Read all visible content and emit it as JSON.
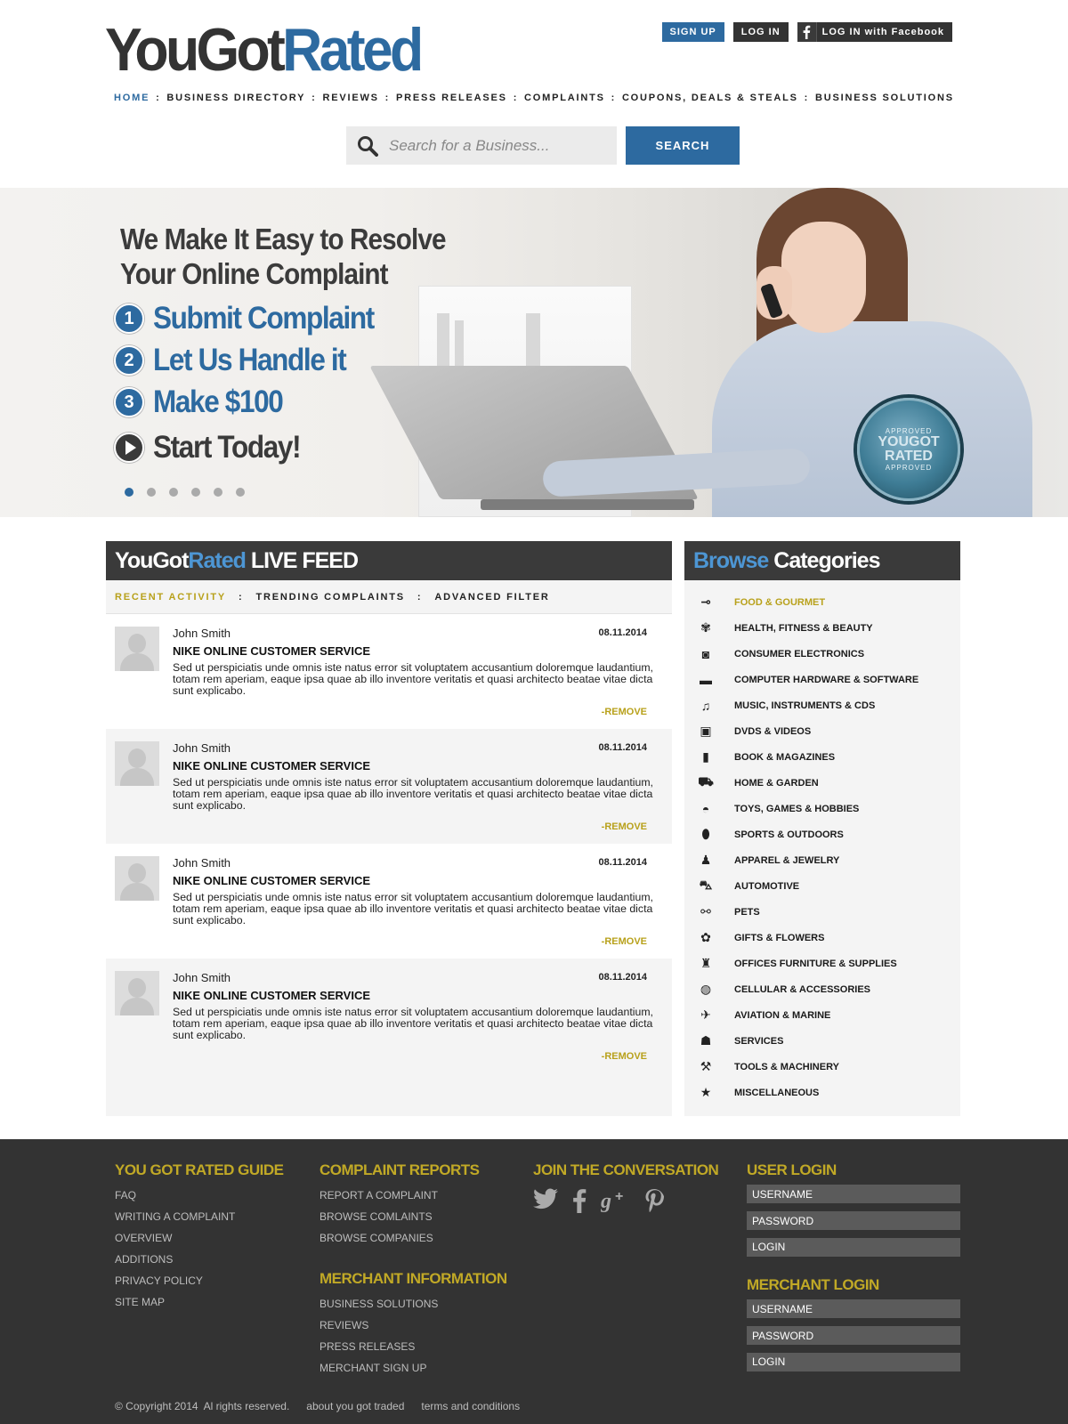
{
  "brand": {
    "part1": "YouGot",
    "part2": "Rated"
  },
  "auth": {
    "signup": "SIGN UP",
    "login": "LOG IN",
    "facebook": "LOG IN with Facebook"
  },
  "nav": {
    "items": [
      "HOME",
      "BUSINESS DIRECTORY",
      "REVIEWS",
      "PRESS RELEASES",
      "COMPLAINTS",
      "COUPONS, DEALS & STEALS",
      "BUSINESS SOLUTIONS"
    ],
    "separator": ":"
  },
  "search": {
    "placeholder": "Search for a Business...",
    "button": "SEARCH"
  },
  "hero": {
    "title_line1": "We Make It Easy to Resolve",
    "title_line2": "Your Online Complaint",
    "steps": [
      {
        "num": "1",
        "label": "Submit Complaint"
      },
      {
        "num": "2",
        "label": "Let Us Handle it"
      },
      {
        "num": "3",
        "label": "Make $100"
      }
    ],
    "cta": "Start Today!",
    "badge": {
      "top": "APPROVED",
      "line1": "YOUGOT",
      "line2": "RATED",
      "bottom": "APPROVED"
    }
  },
  "feed": {
    "head_part1": "YouGot",
    "head_part2": "Rated",
    "head_part3": " LIVE FEED",
    "tabs": [
      "RECENT ACTIVITY",
      "TRENDING COMPLAINTS",
      "ADVANCED FILTER"
    ],
    "items": [
      {
        "name": "John Smith",
        "date": "08.11.2014",
        "title": "NIKE ONLINE CUSTOMER SERVICE",
        "text": "Sed ut perspiciatis unde omnis iste natus error sit voluptatem accusantium doloremque laudantium, totam rem aperiam, eaque ipsa quae ab illo inventore veritatis et quasi architecto beatae vitae dicta sunt explicabo.",
        "remove": "-REMOVE"
      },
      {
        "name": "John Smith",
        "date": "08.11.2014",
        "title": "NIKE ONLINE CUSTOMER SERVICE",
        "text": "Sed ut perspiciatis unde omnis iste natus error sit voluptatem accusantium doloremque laudantium, totam rem aperiam, eaque ipsa quae ab illo inventore veritatis et quasi architecto beatae vitae dicta sunt explicabo.",
        "remove": "-REMOVE"
      },
      {
        "name": "John Smith",
        "date": "08.11.2014",
        "title": "NIKE ONLINE CUSTOMER SERVICE",
        "text": "Sed ut perspiciatis unde omnis iste natus error sit voluptatem accusantium doloremque laudantium, totam rem aperiam, eaque ipsa quae ab illo inventore veritatis et quasi architecto beatae vitae dicta sunt explicabo.",
        "remove": "-REMOVE"
      },
      {
        "name": "John Smith",
        "date": "08.11.2014",
        "title": "NIKE ONLINE CUSTOMER SERVICE",
        "text": "Sed ut perspiciatis unde omnis iste natus error sit voluptatem accusantium doloremque laudantium, totam rem aperiam, eaque ipsa quae ab illo inventore veritatis et quasi architecto beatae vitae dicta sunt explicabo.",
        "remove": "-REMOVE"
      }
    ]
  },
  "categories": {
    "head_part1": "Browse",
    "head_part2": " Categories",
    "items": [
      {
        "label": "FOOD & GOURMET",
        "icon": "fork-icon",
        "glyph": "⊸"
      },
      {
        "label": "HEALTH, FITNESS & BEAUTY",
        "icon": "butterfly-icon",
        "glyph": "✾"
      },
      {
        "label": "CONSUMER ELECTRONICS",
        "icon": "camera-icon",
        "glyph": "◙"
      },
      {
        "label": "COMPUTER HARDWARE & SOFTWARE",
        "icon": "laptop-icon",
        "glyph": "▬"
      },
      {
        "label": "MUSIC, INSTRUMENTS & CDS",
        "icon": "music-note-icon",
        "glyph": "♫"
      },
      {
        "label": "DVDS & VIDEOS",
        "icon": "film-icon",
        "glyph": "▣"
      },
      {
        "label": "BOOK & MAGAZINES",
        "icon": "book-icon",
        "glyph": "▮"
      },
      {
        "label": "HOME & GARDEN",
        "icon": "wheelbarrow-icon",
        "glyph": "⛟"
      },
      {
        "label": "TOYS, GAMES & HOBBIES",
        "icon": "gamepad-icon",
        "glyph": "◓"
      },
      {
        "label": "SPORTS & OUTDOORS",
        "icon": "football-icon",
        "glyph": "⬮"
      },
      {
        "label": "APPAREL & JEWELRY",
        "icon": "dress-icon",
        "glyph": "♟"
      },
      {
        "label": "AUTOMOTIVE",
        "icon": "car-icon",
        "glyph": "⛍"
      },
      {
        "label": "PETS",
        "icon": "bone-icon",
        "glyph": "⚯"
      },
      {
        "label": "GIFTS & FLOWERS",
        "icon": "flower-icon",
        "glyph": "✿"
      },
      {
        "label": "OFFICES FURNITURE & SUPPLIES",
        "icon": "chair-icon",
        "glyph": "♜"
      },
      {
        "label": "CELLULAR & ACCESSORIES",
        "icon": "globe-icon",
        "glyph": "◍"
      },
      {
        "label": "AVIATION & MARINE",
        "icon": "airplane-icon",
        "glyph": "✈"
      },
      {
        "label": "SERVICES",
        "icon": "person-icon",
        "glyph": "☗"
      },
      {
        "label": "TOOLS & MACHINERY",
        "icon": "wrench-icon",
        "glyph": "⚒"
      },
      {
        "label": "MISCELLANEOUS",
        "icon": "star-icon",
        "glyph": "★"
      }
    ]
  },
  "footer": {
    "guide": {
      "title": "YOU GOT RATED GUIDE",
      "links": [
        "FAQ",
        "WRITING A COMPLAINT",
        "OVERVIEW",
        "ADDITIONS",
        "PRIVACY POLICY",
        "SITE MAP"
      ]
    },
    "reports": {
      "title": "COMPLAINT REPORTS",
      "links": [
        "REPORT A COMPLAINT",
        "BROWSE COMLAINTS",
        "BROWSE COMPANIES"
      ]
    },
    "merchant": {
      "title": "MERCHANT INFORMATION",
      "links": [
        "BUSINESS SOLUTIONS",
        "REVIEWS",
        "PRESS RELEASES",
        "MERCHANT SIGN UP"
      ]
    },
    "social": {
      "title": "JOIN THE CONVERSATION"
    },
    "user_login": {
      "title": "USER LOGIN",
      "username": "USERNAME",
      "password": "PASSWORD",
      "button": "LOGIN"
    },
    "merchant_login": {
      "title": "MERCHANT LOGIN",
      "username": "USERNAME",
      "password": "PASSWORD",
      "button": "LOGIN"
    },
    "copyright": "© Copyright 2014  Al rights reserved.",
    "about": "about you got traded",
    "terms": "terms and conditions"
  },
  "colors": {
    "brand_blue": "#2d6aa0",
    "accent_gold": "#c1a926",
    "dark": "#333333"
  }
}
